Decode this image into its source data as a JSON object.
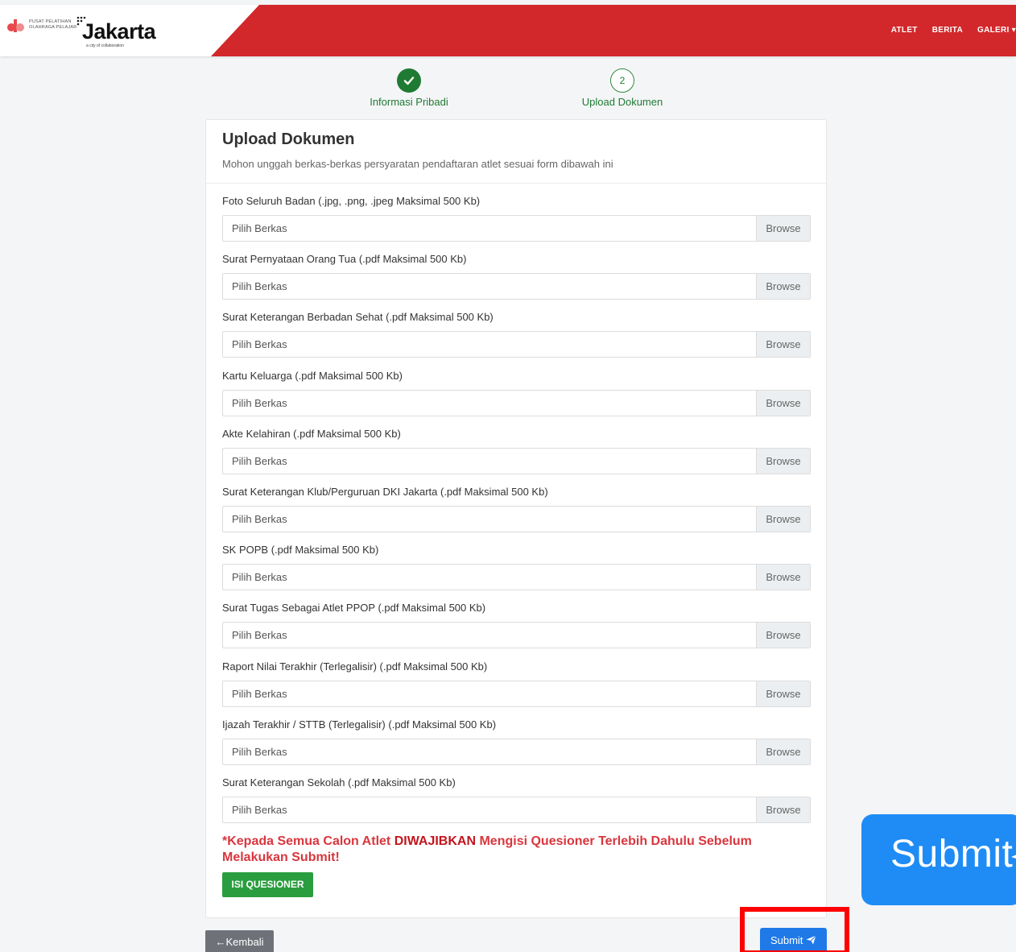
{
  "header": {
    "logo_small_line1": "PUSAT PELATIHAN",
    "logo_small_line2": "OLAHRAGA PELAJAR",
    "logo_big": "Jakarta",
    "logo_tag": "a city of collaboration",
    "nav": [
      {
        "label": "ATLET"
      },
      {
        "label": "BERITA"
      },
      {
        "label": "GALERI"
      }
    ],
    "brand_color": "#d2282b"
  },
  "stepper": {
    "steps": [
      {
        "label": "Informasi Pribadi",
        "state": "done",
        "icon": "check-icon"
      },
      {
        "label": "Upload Dokumen",
        "state": "current",
        "number": "2"
      }
    ]
  },
  "card": {
    "title": "Upload Dokumen",
    "subtitle": "Mohon unggah berkas-berkas persyaratan pendaftaran atlet sesuai form dibawah ini",
    "fields": [
      {
        "label": "Foto Seluruh Badan (.jpg, .png, .jpeg Maksimal 500 Kb)",
        "placeholder": "Pilih Berkas",
        "browse": "Browse"
      },
      {
        "label": "Surat Pernyataan Orang Tua (.pdf Maksimal 500 Kb)",
        "placeholder": "Pilih Berkas",
        "browse": "Browse"
      },
      {
        "label": "Surat Keterangan Berbadan Sehat (.pdf Maksimal 500 Kb)",
        "placeholder": "Pilih Berkas",
        "browse": "Browse"
      },
      {
        "label": "Kartu Keluarga (.pdf Maksimal 500 Kb)",
        "placeholder": "Pilih Berkas",
        "browse": "Browse"
      },
      {
        "label": "Akte Kelahiran (.pdf Maksimal 500 Kb)",
        "placeholder": "Pilih Berkas",
        "browse": "Browse"
      },
      {
        "label": "Surat Keterangan Klub/Perguruan DKI Jakarta (.pdf Maksimal 500 Kb)",
        "placeholder": "Pilih Berkas",
        "browse": "Browse"
      },
      {
        "label": "SK POPB (.pdf Maksimal 500 Kb)",
        "placeholder": "Pilih Berkas",
        "browse": "Browse"
      },
      {
        "label": "Surat Tugas Sebagai Atlet PPOP (.pdf Maksimal 500 Kb)",
        "placeholder": "Pilih Berkas",
        "browse": "Browse"
      },
      {
        "label": "Raport Nilai Terakhir (Terlegalisir) (.pdf Maksimal 500 Kb)",
        "placeholder": "Pilih Berkas",
        "browse": "Browse"
      },
      {
        "label": "Ijazah Terakhir / STTB (Terlegalisir) (.pdf Maksimal 500 Kb)",
        "placeholder": "Pilih Berkas",
        "browse": "Browse"
      },
      {
        "label": "Surat Keterangan Sekolah (.pdf Maksimal 500 Kb)",
        "placeholder": "Pilih Berkas",
        "browse": "Browse"
      }
    ],
    "warning_prefix": "*Kepada Semua Calon Atlet ",
    "warning_strong": "DIWAJIBKAN",
    "warning_suffix": " Mengisi Quesioner Terlebih Dahulu Sebelum Melakukan Submit!",
    "quesioner_label": "ISI QUESIONER"
  },
  "footer": {
    "back_label": "Kembali",
    "submit_label": "Submit"
  },
  "zoom_callout": {
    "label": "Submit"
  },
  "colors": {
    "success": "#1f7a33",
    "primary": "#1f7ae8",
    "danger": "#d9363e",
    "highlight": "#ff0000"
  }
}
